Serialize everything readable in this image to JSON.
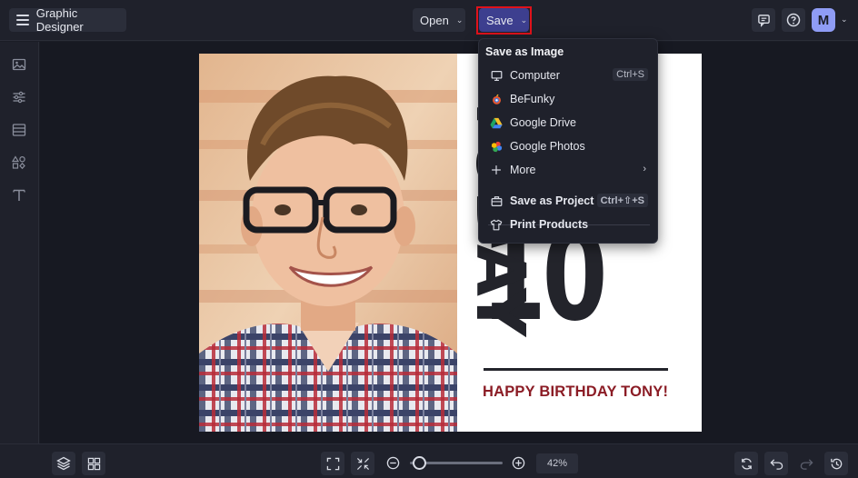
{
  "header": {
    "app_title": "Graphic Designer",
    "open_label": "Open",
    "save_label": "Save",
    "avatar_initial": "M"
  },
  "save_menu": {
    "section_title": "Save as Image",
    "items": [
      {
        "label": "Computer",
        "icon": "monitor-icon",
        "shortcut": "Ctrl+S"
      },
      {
        "label": "BeFunky",
        "icon": "befunky-icon"
      },
      {
        "label": "Google Drive",
        "icon": "google-drive-icon"
      },
      {
        "label": "Google Photos",
        "icon": "google-photos-icon"
      },
      {
        "label": "More",
        "icon": "plus-icon"
      },
      {
        "label": "Save as Project",
        "icon": "briefcase-icon",
        "shortcut": "Ctrl+⇧+S"
      },
      {
        "label": "Print Products",
        "icon": "tshirt-icon"
      }
    ]
  },
  "artboard": {
    "vertical_word": "TODAY",
    "number": "10",
    "greeting": "HAPPY BIRTHDAY TONY!"
  },
  "bottom": {
    "zoom_value": "42%",
    "zoom_level": 0.42
  },
  "colors": {
    "accent_save": "#3d3f8f",
    "highlight": "#e0121b",
    "greeting": "#8b1c25",
    "avatar": "#8f9cf5"
  }
}
